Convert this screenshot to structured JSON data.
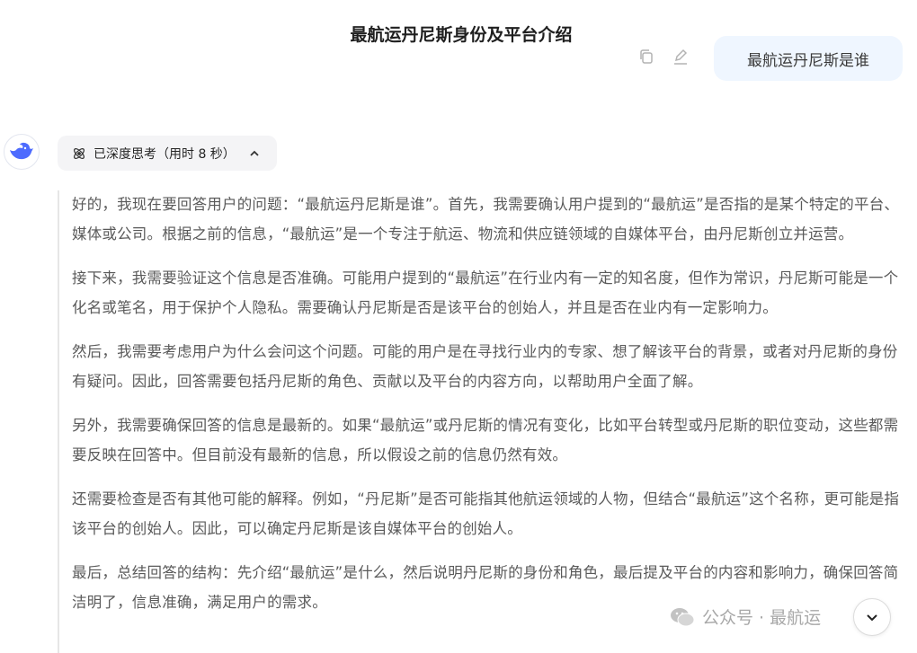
{
  "header": {
    "title": "最航运丹尼斯身份及平台介绍"
  },
  "user_message": {
    "text": "最航运丹尼斯是谁",
    "actions": [
      {
        "icon": "copy-icon"
      },
      {
        "icon": "edit-icon"
      }
    ]
  },
  "assistant": {
    "avatar_icon": "whale-logo-icon",
    "brand_color": "#4d6bfe",
    "think_toggle": {
      "label": "已深度思考（用时 8 秒）",
      "icon": "atom-icon",
      "chevron": "chevron-up-icon"
    },
    "thought_paragraphs": [
      "好的，我现在要回答用户的问题：“最航运丹尼斯是谁”。首先，我需要确认用户提到的“最航运”是否指的是某个特定的平台、媒体或公司。根据之前的信息，“最航运”是一个专注于航运、物流和供应链领域的自媒体平台，由丹尼斯创立并运营。",
      "接下来，我需要验证这个信息是否准确。可能用户提到的“最航运”在行业内有一定的知名度，但作为常识，丹尼斯可能是一个化名或笔名，用于保护个人隐私。需要确认丹尼斯是否是该平台的创始人，并且是否在业内有一定影响力。",
      "然后，我需要考虑用户为什么会问这个问题。可能的用户是在寻找行业内的专家、想了解该平台的背景，或者对丹尼斯的身份有疑问。因此，回答需要包括丹尼斯的角色、贡献以及平台的内容方向，以帮助用户全面了解。",
      "另外，我需要确保回答的信息是最新的。如果“最航运”或丹尼斯的情况有变化，比如平台转型或丹尼斯的职位变动，这些都需要反映在回答中。但目前没有最新的信息，所以假设之前的信息仍然有效。",
      "还需要检查是否有其他可能的解释。例如，“丹尼斯”是否可能指其他航运领域的人物，但结合“最航运”这个名称，更可能是指该平台的创始人。因此，可以确定丹尼斯是该自媒体平台的创始人。",
      "最后，总结回答的结构：先介绍“最航运”是什么，然后说明丹尼斯的身份和角色，最后提及平台的内容和影响力，确保回答简洁明了，信息准确，满足用户的需求。"
    ]
  },
  "watermark": {
    "text": "公众号 · 最航运",
    "icon": "wechat-icon"
  },
  "scroll_button": {
    "icon": "chevron-down-icon"
  }
}
